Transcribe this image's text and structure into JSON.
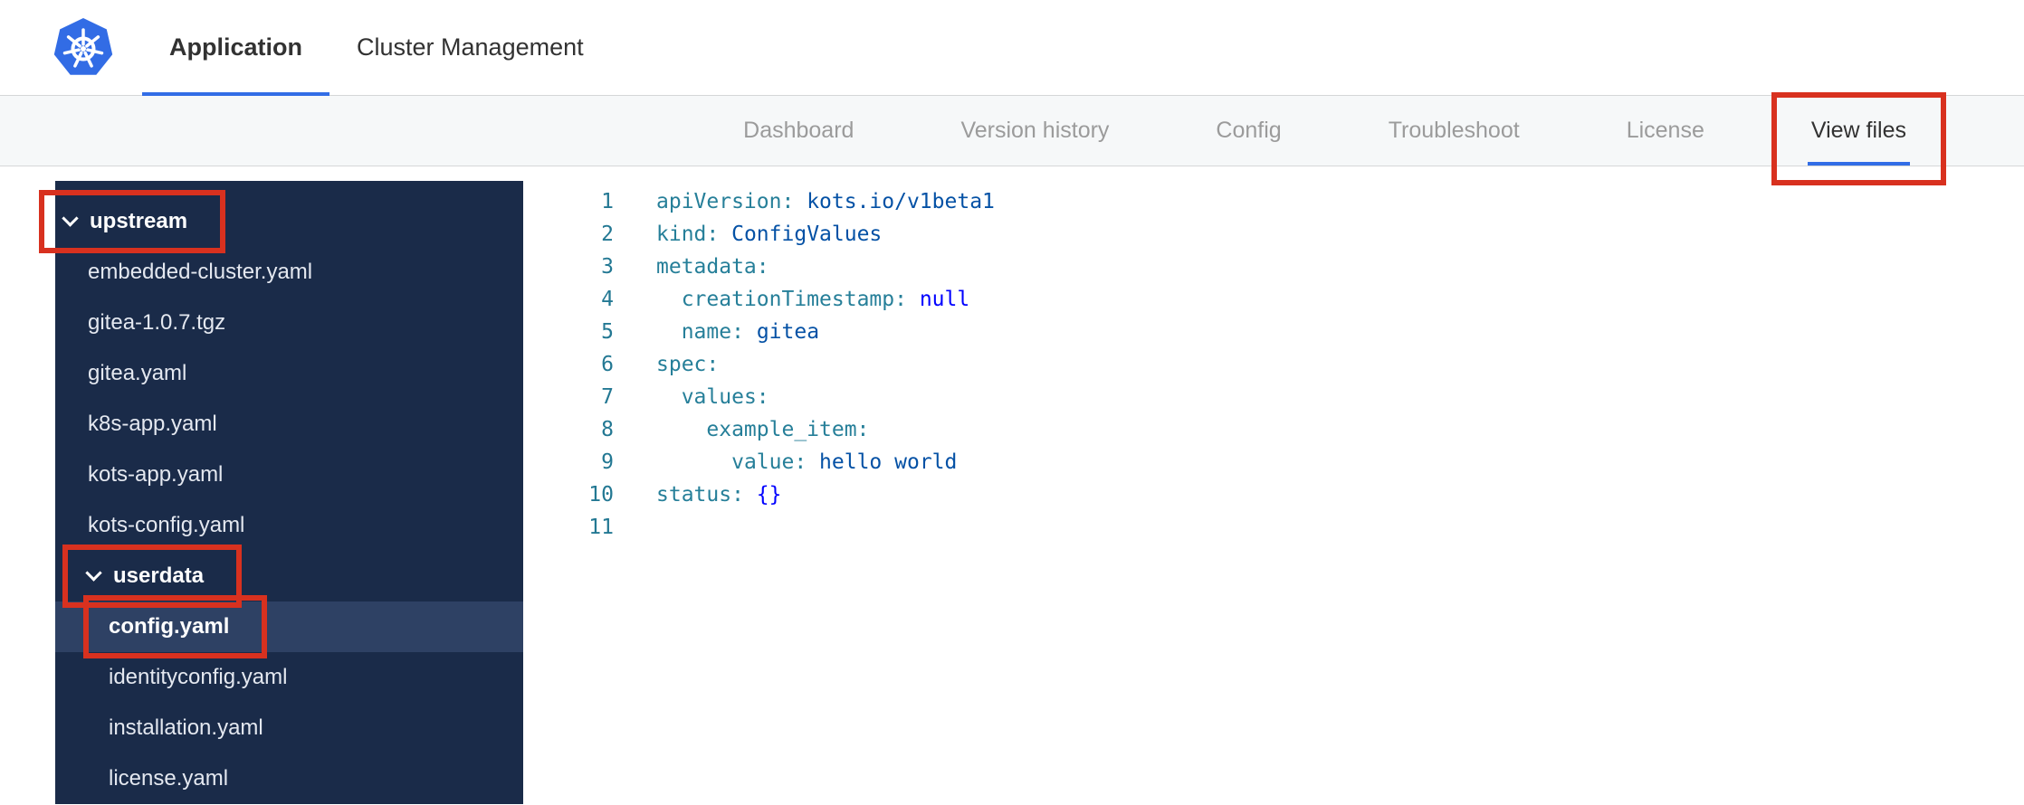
{
  "brand": {
    "logo_icon": "kubernetes-logo"
  },
  "top_tabs": [
    {
      "label": "Application",
      "active": true
    },
    {
      "label": "Cluster Management",
      "active": false
    }
  ],
  "subnav": [
    {
      "label": "Dashboard",
      "active": false,
      "annotated": false
    },
    {
      "label": "Version history",
      "active": false,
      "annotated": false
    },
    {
      "label": "Config",
      "active": false,
      "annotated": false
    },
    {
      "label": "Troubleshoot",
      "active": false,
      "annotated": false
    },
    {
      "label": "License",
      "active": false,
      "annotated": false
    },
    {
      "label": "View files",
      "active": true,
      "annotated": true
    }
  ],
  "file_tree": [
    {
      "kind": "folder",
      "label": "upstream",
      "depth": 0,
      "expanded": true,
      "annotated": true,
      "selected": false
    },
    {
      "kind": "file",
      "label": "embedded-cluster.yaml",
      "depth": 1,
      "annotated": false,
      "selected": false
    },
    {
      "kind": "file",
      "label": "gitea-1.0.7.tgz",
      "depth": 1,
      "annotated": false,
      "selected": false
    },
    {
      "kind": "file",
      "label": "gitea.yaml",
      "depth": 1,
      "annotated": false,
      "selected": false
    },
    {
      "kind": "file",
      "label": "k8s-app.yaml",
      "depth": 1,
      "annotated": false,
      "selected": false
    },
    {
      "kind": "file",
      "label": "kots-app.yaml",
      "depth": 1,
      "annotated": false,
      "selected": false
    },
    {
      "kind": "file",
      "label": "kots-config.yaml",
      "depth": 1,
      "annotated": false,
      "selected": false
    },
    {
      "kind": "folder",
      "label": "userdata",
      "depth": 1,
      "expanded": true,
      "annotated": true,
      "selected": false
    },
    {
      "kind": "file",
      "label": "config.yaml",
      "depth": 2,
      "annotated": true,
      "selected": true
    },
    {
      "kind": "file",
      "label": "identityconfig.yaml",
      "depth": 2,
      "annotated": false,
      "selected": false
    },
    {
      "kind": "file",
      "label": "installation.yaml",
      "depth": 2,
      "annotated": false,
      "selected": false
    },
    {
      "kind": "file",
      "label": "license.yaml",
      "depth": 2,
      "annotated": false,
      "selected": false
    }
  ],
  "editor": {
    "lines": [
      {
        "num": "1",
        "tokens": [
          [
            "key",
            "apiVersion:"
          ],
          [
            "pl",
            " "
          ],
          [
            "str",
            "kots.io/v1beta1"
          ]
        ]
      },
      {
        "num": "2",
        "tokens": [
          [
            "key",
            "kind:"
          ],
          [
            "pl",
            " "
          ],
          [
            "str",
            "ConfigValues"
          ]
        ]
      },
      {
        "num": "3",
        "tokens": [
          [
            "key",
            "metadata:"
          ]
        ]
      },
      {
        "num": "4",
        "tokens": [
          [
            "pl",
            "  "
          ],
          [
            "key",
            "creationTimestamp:"
          ],
          [
            "pl",
            " "
          ],
          [
            "kw",
            "null"
          ]
        ]
      },
      {
        "num": "5",
        "tokens": [
          [
            "pl",
            "  "
          ],
          [
            "key",
            "name:"
          ],
          [
            "pl",
            " "
          ],
          [
            "str",
            "gitea"
          ]
        ]
      },
      {
        "num": "6",
        "tokens": [
          [
            "key",
            "spec:"
          ]
        ]
      },
      {
        "num": "7",
        "tokens": [
          [
            "pl",
            "  "
          ],
          [
            "key",
            "values:"
          ]
        ]
      },
      {
        "num": "8",
        "tokens": [
          [
            "pl",
            "    "
          ],
          [
            "key",
            "example_item:"
          ]
        ]
      },
      {
        "num": "9",
        "tokens": [
          [
            "pl",
            "      "
          ],
          [
            "key",
            "value:"
          ],
          [
            "pl",
            " "
          ],
          [
            "str",
            "hello world"
          ]
        ]
      },
      {
        "num": "10",
        "tokens": [
          [
            "key",
            "status:"
          ],
          [
            "pl",
            " "
          ],
          [
            "kw",
            "{}"
          ]
        ]
      },
      {
        "num": "11",
        "tokens": []
      }
    ]
  },
  "colors": {
    "accent_blue": "#326de6",
    "annotation_red": "#d8311f",
    "sidebar_bg": "#1a2b49",
    "sidebar_selected": "#2e4164",
    "token_key": "#267f99",
    "token_string": "#0451a5",
    "token_keyword": "#0000ff",
    "line_number": "#237893",
    "nav_inactive": "#9b9b9b",
    "nav_active": "#323232",
    "kubernetes_blue": "#326ce5"
  }
}
